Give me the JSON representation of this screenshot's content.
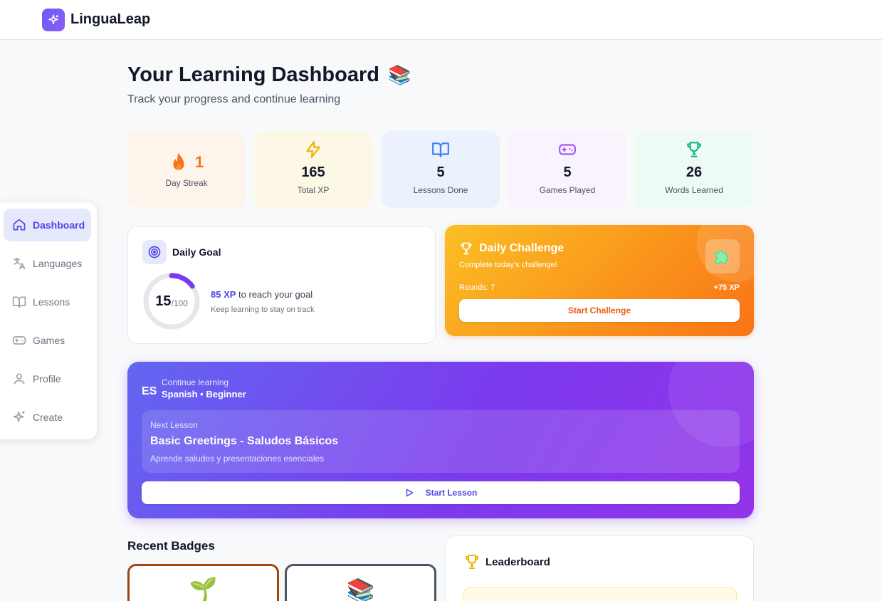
{
  "app": {
    "name": "LinguaLeap"
  },
  "sidebar": {
    "items": [
      {
        "label": "Dashboard",
        "icon": "home-icon"
      },
      {
        "label": "Languages",
        "icon": "translate-icon"
      },
      {
        "label": "Lessons",
        "icon": "book-icon"
      },
      {
        "label": "Games",
        "icon": "gamepad-icon"
      },
      {
        "label": "Profile",
        "icon": "user-icon"
      },
      {
        "label": "Create",
        "icon": "sparkles-icon"
      }
    ],
    "active": "Dashboard"
  },
  "header": {
    "title": "Your Learning Dashboard",
    "title_emoji": "📚",
    "subtitle": "Track your progress and continue learning"
  },
  "stats": [
    {
      "value": "1",
      "label": "Day Streak",
      "icon": "fire-icon",
      "color": "#f97316"
    },
    {
      "value": "165",
      "label": "Total XP",
      "icon": "lightning-icon",
      "color": "#eab308"
    },
    {
      "value": "5",
      "label": "Lessons Done",
      "icon": "book-icon",
      "color": "#3b82f6"
    },
    {
      "value": "5",
      "label": "Games Played",
      "icon": "gamepad-icon",
      "color": "#a855f7"
    },
    {
      "value": "26",
      "label": "Words Learned",
      "icon": "trophy-icon",
      "color": "#10b981"
    }
  ],
  "daily_goal": {
    "title": "Daily Goal",
    "current": "15",
    "target": "/100",
    "progress": 0.15,
    "remaining_xp": "85 XP",
    "remaining_text": "to reach your goal",
    "hint": "Keep learning to stay on track"
  },
  "daily_challenge": {
    "title": "Daily Challenge",
    "subtitle": "Complete today's challenge!",
    "rounds": "Rounds: 7",
    "reward": "+75 XP",
    "button": "Start Challenge",
    "icon": "puzzle-icon"
  },
  "continue": {
    "flag": "ES",
    "label": "Continue learning",
    "course": "Spanish • Beginner",
    "next_label": "Next Lesson",
    "lesson_title": "Basic Greetings - Saludos Básicos",
    "lesson_desc": "Aprende saludos y presentaciones esenciales",
    "button": "Start Lesson"
  },
  "badges": {
    "title": "Recent Badges",
    "items": [
      {
        "icon": "seedling-icon",
        "emoji": "🌱"
      },
      {
        "icon": "books-icon",
        "emoji": "📚"
      }
    ]
  },
  "leaderboard": {
    "title": "Leaderboard"
  },
  "colors": {
    "accent": "#4f46e5",
    "purple": "#7c3aed",
    "orange": "#f97316"
  }
}
